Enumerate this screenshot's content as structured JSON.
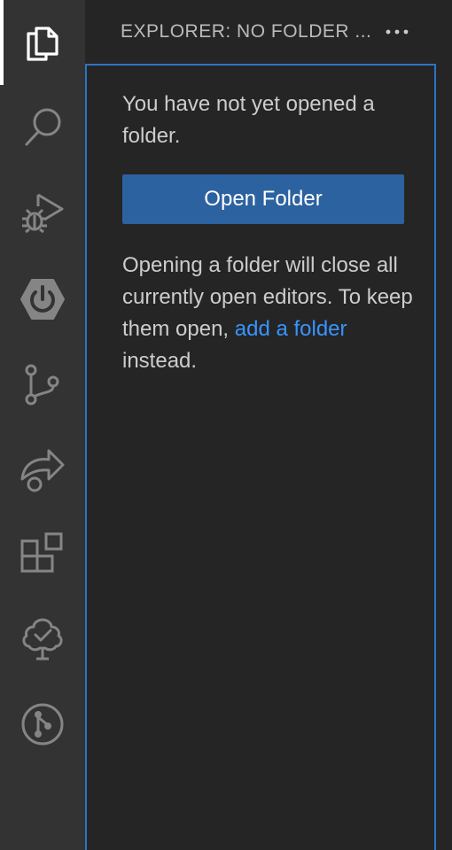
{
  "activity_bar": {
    "items": [
      {
        "name": "explorer",
        "icon": "files-icon",
        "active": true
      },
      {
        "name": "search",
        "icon": "search-icon",
        "active": false
      },
      {
        "name": "run-and-debug",
        "icon": "run-debug-icon",
        "active": false
      },
      {
        "name": "power",
        "icon": "power-hexagon-icon",
        "active": false
      },
      {
        "name": "source-control",
        "icon": "source-control-icon",
        "active": false
      },
      {
        "name": "remote-share",
        "icon": "share-arrow-icon",
        "active": false
      },
      {
        "name": "extensions",
        "icon": "extensions-icon",
        "active": false
      },
      {
        "name": "tree-check",
        "icon": "tree-check-icon",
        "active": false
      },
      {
        "name": "git-graph",
        "icon": "git-circle-icon",
        "active": false
      }
    ],
    "colors": {
      "background": "#333333",
      "icon": "#858585",
      "icon_active": "#ffffff"
    }
  },
  "sidebar": {
    "title": "EXPLORER: NO FOLDER ...",
    "more_actions_icon": "ellipsis-icon",
    "empty_message": "You have not yet opened a folder.",
    "open_folder_label": "Open Folder",
    "note_prefix": "Opening a folder will close all currently open editors. To keep them open, ",
    "note_link": "add a folder",
    "note_suffix": " instead.",
    "colors": {
      "background": "#252526",
      "button": "#2c62a0",
      "link": "#3794ff",
      "focus_border": "#2a74c4"
    }
  }
}
